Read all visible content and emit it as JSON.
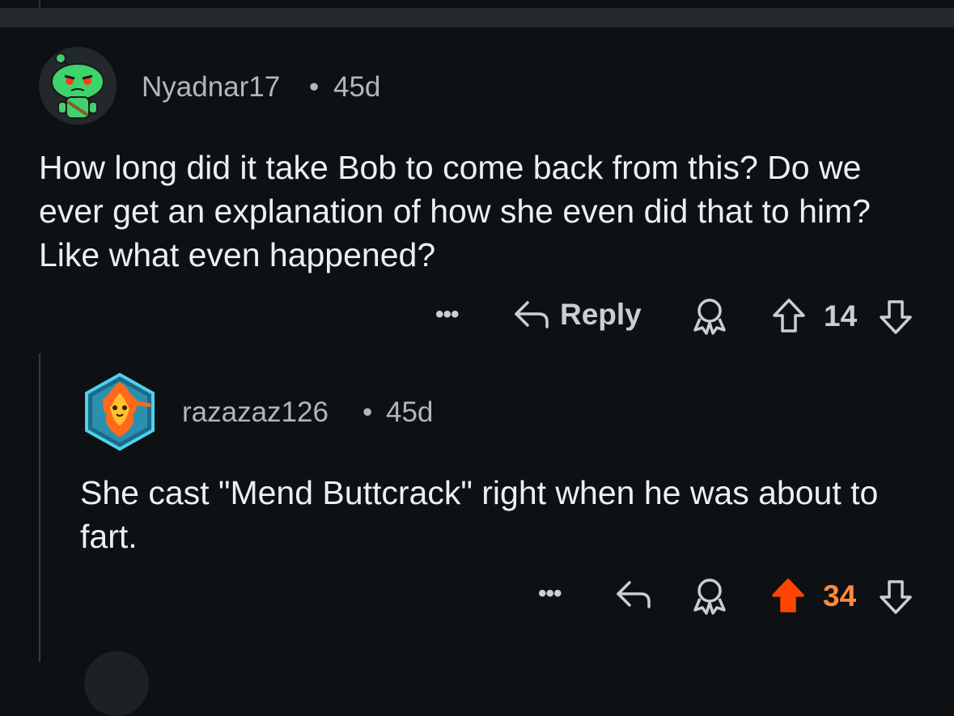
{
  "comments": [
    {
      "username": "Nyadnar17",
      "separator": "•",
      "age": "45d",
      "body": "How long did it take Bob to come back from this? Do we ever get an explanation of how she even did that to him? Like what even happened?",
      "reply_label": "Reply",
      "score": "14",
      "avatar_icon": "snoo-green-avatar-icon",
      "upvoted": false
    },
    {
      "username": "razazaz126",
      "separator": "•",
      "age": "45d",
      "body": "She cast \"Mend Buttcrack\" right when he was about to fart.",
      "score": "34",
      "avatar_icon": "fire-creature-avatar-icon",
      "upvoted": true
    }
  ],
  "colors": {
    "background": "#0e1113",
    "upvote_active": "#ff4500",
    "score_active": "#ff8a3d",
    "muted_text": "#aeb8bd"
  }
}
